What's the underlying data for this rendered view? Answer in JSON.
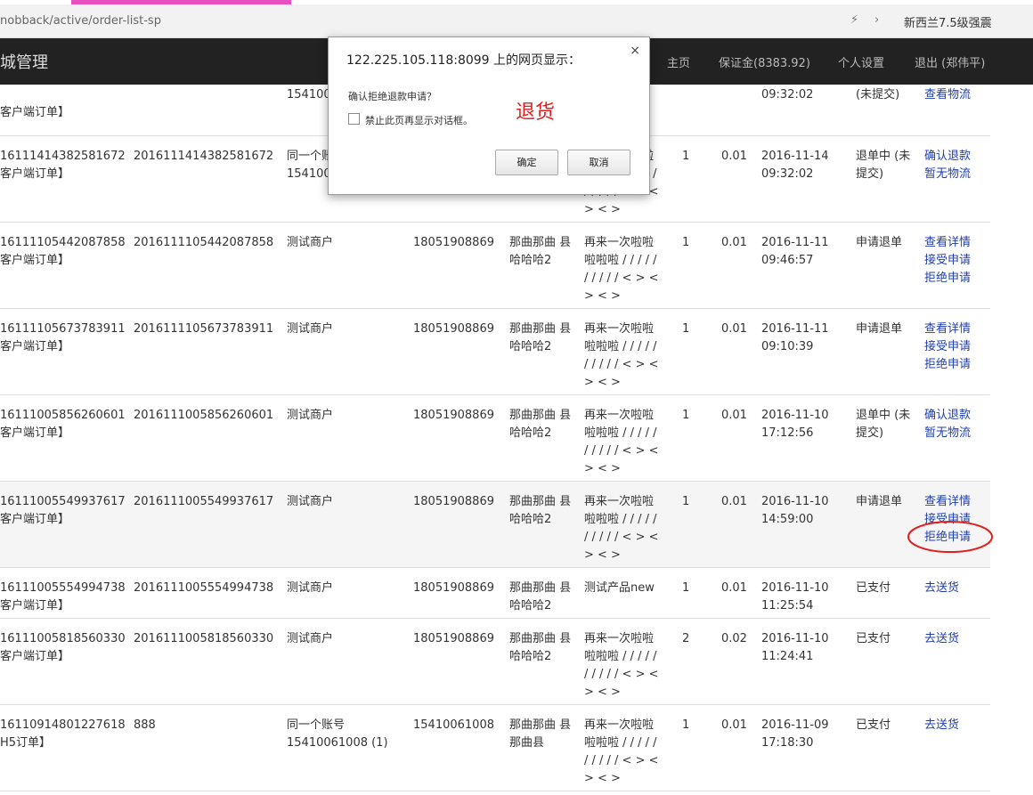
{
  "browser": {
    "url": "nobback/active/order-list-sp",
    "news": "新西兰7.5级强震",
    "bolt_icon": "⚡",
    "chevron": "›"
  },
  "navbar": {
    "brand": "城管理",
    "items": [
      "主页",
      "保证金(8383.92)",
      "个人设置",
      "退出 (郑伟平)"
    ]
  },
  "rows": [
    {
      "order_id": "",
      "suborder_id": "",
      "merchant": "15410061008 (1)",
      "phone": "",
      "address": "",
      "product": "/",
      "qty": "",
      "amount": "",
      "date": "09:32:02",
      "status": "(未提交)",
      "source": "客户端订单】",
      "actions": [
        "查看物流"
      ]
    },
    {
      "order_id": "16111414382581672",
      "suborder_id": "2016111414382581672",
      "merchant": "同一个账号 15410061008 (1)",
      "phone": "",
      "address": "",
      "product": "再来一次啦啦 啦啦啦 / / / / / / / / / / < > < > < >",
      "qty": "1",
      "amount": "0.01",
      "date": "2016-11-14 09:32:02",
      "status": "退单中 (未提交)",
      "source": "客户端订单】",
      "actions": [
        "确认退款",
        "暂无物流"
      ]
    },
    {
      "order_id": "16111105442087858",
      "suborder_id": "2016111105442087858",
      "merchant": "测试商户",
      "phone": "18051908869",
      "address": "那曲那曲 县哈哈哈2",
      "product": "再来一次啦啦 啦啦啦 / / / / / / / / / / < > < > < >",
      "qty": "1",
      "amount": "0.01",
      "date": "2016-11-11 09:46:57",
      "status": "申请退单",
      "source": "客户端订单】",
      "actions": [
        "查看详情",
        "接受申请",
        "拒绝申请"
      ]
    },
    {
      "order_id": "16111105673783911",
      "suborder_id": "2016111105673783911",
      "merchant": "测试商户",
      "phone": "18051908869",
      "address": "那曲那曲 县哈哈哈2",
      "product": "再来一次啦啦 啦啦啦 / / / / / / / / / / < > < > < >",
      "qty": "1",
      "amount": "0.01",
      "date": "2016-11-11 09:10:39",
      "status": "申请退单",
      "source": "客户端订单】",
      "actions": [
        "查看详情",
        "接受申请",
        "拒绝申请"
      ]
    },
    {
      "order_id": "16111005856260601",
      "suborder_id": "2016111005856260601",
      "merchant": "测试商户",
      "phone": "18051908869",
      "address": "那曲那曲 县哈哈哈2",
      "product": "再来一次啦啦 啦啦啦 / / / / / / / / / / < > < > < >",
      "qty": "1",
      "amount": "0.01",
      "date": "2016-11-10 17:12:56",
      "status": "退单中 (未提交)",
      "source": "客户端订单】",
      "actions": [
        "确认退款",
        "暂无物流"
      ]
    },
    {
      "order_id": "16111005549937617",
      "suborder_id": "2016111005549937617",
      "merchant": "测试商户",
      "phone": "18051908869",
      "address": "那曲那曲 县哈哈哈2",
      "product": "再来一次啦啦 啦啦啦 / / / / / / / / / / < > < > < >",
      "qty": "1",
      "amount": "0.01",
      "date": "2016-11-10 14:59:00",
      "status": "申请退单",
      "source": "客户端订单】",
      "actions": [
        "查看详情",
        "接受申请",
        "拒绝申请"
      ]
    },
    {
      "order_id": "16111005554994738",
      "suborder_id": "2016111005554994738",
      "merchant": "测试商户",
      "phone": "18051908869",
      "address": "那曲那曲 县哈哈哈2",
      "product": "测试产品new",
      "qty": "1",
      "amount": "0.01",
      "date": "2016-11-10 11:25:54",
      "status": "已支付",
      "source": "客户端订单】",
      "actions": [
        "去送货"
      ]
    },
    {
      "order_id": "16111005818560330",
      "suborder_id": "2016111005818560330",
      "merchant": "测试商户",
      "phone": "18051908869",
      "address": "那曲那曲 县哈哈哈2",
      "product": "再来一次啦啦 啦啦啦 / / / / / / / / / / < > < > < >",
      "qty": "2",
      "amount": "0.02",
      "date": "2016-11-10 11:24:41",
      "status": "已支付",
      "source": "客户端订单】",
      "actions": [
        "去送货"
      ]
    },
    {
      "order_id": "16110914801227618",
      "suborder_id": "888",
      "merchant": "同一个账号 15410061008 (1)",
      "phone": "15410061008",
      "address": "那曲那曲 县那曲县",
      "product": "再来一次啦啦 啦啦啦 / / / / / / / / / / < > < > < >",
      "qty": "1",
      "amount": "0.01",
      "date": "2016-11-09 17:18:30",
      "status": "已支付",
      "source": "H5订单】",
      "actions": [
        "去送货"
      ]
    }
  ],
  "dialog": {
    "title": "122.225.105.118:8099 上的网页显示：",
    "close": "×",
    "message": "确认拒绝退款申请？",
    "checkbox_label": "禁止此页再显示对话框。",
    "ok": "确定",
    "cancel": "取消"
  },
  "annotation": {
    "text": "退货",
    "color": "#e02020"
  }
}
